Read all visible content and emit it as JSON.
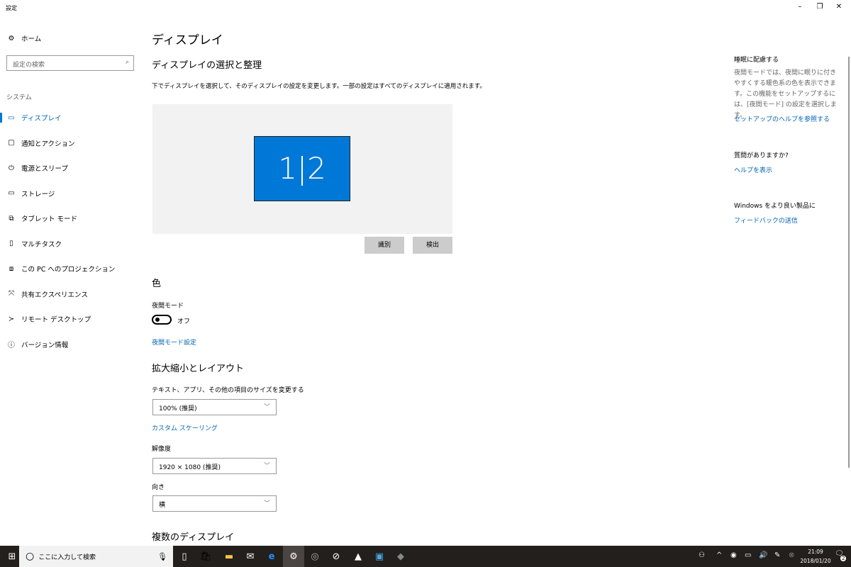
{
  "window": {
    "title": "設定",
    "minimize": "–",
    "restore": "❐",
    "close": "✕"
  },
  "sidebar": {
    "home": "ホーム",
    "search_placeholder": "設定の検索",
    "section": "システム",
    "items": [
      {
        "label": "ディスプレイ",
        "icon": "monitor-icon"
      },
      {
        "label": "通知とアクション",
        "icon": "notification-icon"
      },
      {
        "label": "電源とスリープ",
        "icon": "power-icon"
      },
      {
        "label": "ストレージ",
        "icon": "storage-icon"
      },
      {
        "label": "タブレット モード",
        "icon": "tablet-icon"
      },
      {
        "label": "マルチタスク",
        "icon": "multitask-icon"
      },
      {
        "label": "この PC へのプロジェクション",
        "icon": "projection-icon"
      },
      {
        "label": "共有エクスペリエンス",
        "icon": "shared-icon"
      },
      {
        "label": "リモート デスクトップ",
        "icon": "remote-icon"
      },
      {
        "label": "バージョン情報",
        "icon": "info-icon"
      }
    ]
  },
  "main": {
    "title": "ディスプレイ",
    "arrange_heading": "ディスプレイの選択と整理",
    "arrange_desc": "下でディスプレイを選択して、そのディスプレイの設定を変更します。一部の設定はすべてのディスプレイに適用されます。",
    "monitor_label": "1|2",
    "identify": "識別",
    "detect": "検出",
    "color_heading": "色",
    "night_label": "夜間モード",
    "night_state": "オフ",
    "night_link": "夜間モード設定",
    "scale_heading": "拡大縮小とレイアウト",
    "scale_label": "テキスト、アプリ、その他の項目のサイズを変更する",
    "scale_value": "100% (推奨)",
    "custom_link": "カスタム スケーリング",
    "res_label": "解像度",
    "res_value": "1920 × 1080 (推奨)",
    "orient_label": "向き",
    "orient_value": "横",
    "multi_heading": "複数のディスプレイ"
  },
  "right": {
    "h1": "睡眠に配慮する",
    "p1": "夜間モードでは、夜間に眠りに付きやすくする暖色系の色を表示できます。この機能をセットアップするには、[夜間モード] の設定を選択します。",
    "l1": "セットアップのヘルプを参照する",
    "h2": "質問がありますか?",
    "l2": "ヘルプを表示",
    "h3": "Windows をより良い製品に",
    "l3": "フィードバックの送信"
  },
  "taskbar": {
    "search": "ここに入力して検索",
    "time": "21:09",
    "date": "2018/01/20",
    "notif_count": "2"
  },
  "colors": {
    "accent": "#0078d7",
    "link": "#0063b1"
  }
}
